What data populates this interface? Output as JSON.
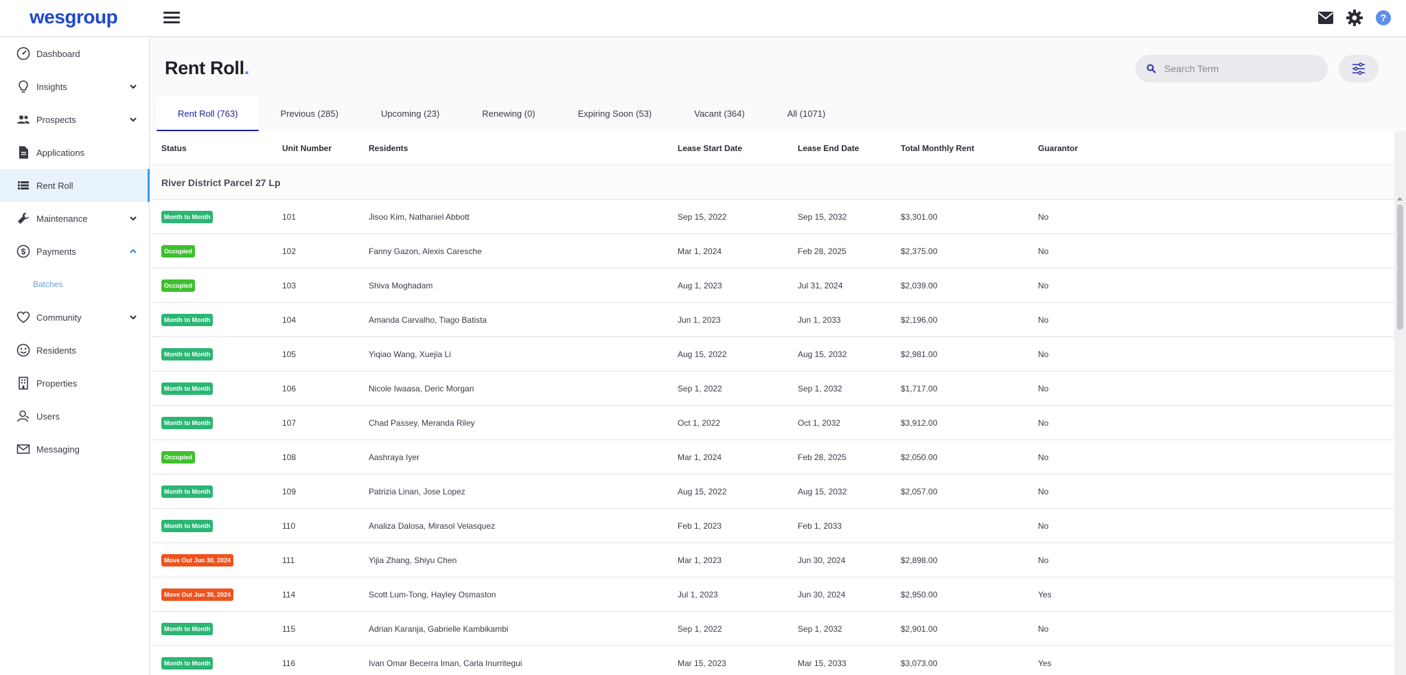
{
  "header": {
    "logo_text": "wesgroup"
  },
  "sidebar": {
    "items": [
      {
        "name": "dashboard",
        "label": "Dashboard",
        "icon": "dashboard-icon"
      },
      {
        "name": "insights",
        "label": "Insights",
        "icon": "lightbulb-icon",
        "expandable": true
      },
      {
        "name": "prospects",
        "label": "Prospects",
        "icon": "people-icon",
        "expandable": true
      },
      {
        "name": "applications",
        "label": "Applications",
        "icon": "document-icon"
      },
      {
        "name": "rent-roll",
        "label": "Rent Roll",
        "icon": "list-icon",
        "active": true
      },
      {
        "name": "maintenance",
        "label": "Maintenance",
        "icon": "wrench-icon",
        "expandable": true
      },
      {
        "name": "payments",
        "label": "Payments",
        "icon": "dollar-icon",
        "expandable": true,
        "expanded": true
      },
      {
        "name": "community",
        "label": "Community",
        "icon": "heart-icon",
        "expandable": true
      },
      {
        "name": "residents",
        "label": "Residents",
        "icon": "smile-icon"
      },
      {
        "name": "properties",
        "label": "Properties",
        "icon": "building-icon"
      },
      {
        "name": "users",
        "label": "Users",
        "icon": "user-icon"
      },
      {
        "name": "messaging",
        "label": "Messaging",
        "icon": "mail-icon"
      }
    ],
    "payments_sub": "Batches"
  },
  "page": {
    "title": "Rent Roll",
    "title_suffix": "."
  },
  "search": {
    "placeholder": "Search Term"
  },
  "tabs": [
    {
      "label": "Rent Roll (763)",
      "active": true
    },
    {
      "label": "Previous (285)"
    },
    {
      "label": "Upcoming (23)"
    },
    {
      "label": "Renewing (0)"
    },
    {
      "label": "Expiring Soon (53)"
    },
    {
      "label": "Vacant (364)"
    },
    {
      "label": "All (1071)"
    }
  ],
  "table": {
    "columns": [
      "Status",
      "Unit Number",
      "Residents",
      "Lease Start Date",
      "Lease End Date",
      "Total Monthly Rent",
      "Guarantor"
    ],
    "group": "River District Parcel 27 Lp",
    "rows": [
      {
        "status": "Month to Month",
        "type": "mtm",
        "unit": "101",
        "residents": "Jisoo Kim, Nathaniel Abbott",
        "start": "Sep 15, 2022",
        "end": "Sep 15, 2032",
        "rent": "$3,301.00",
        "guarantor": "No"
      },
      {
        "status": "Occupied",
        "type": "occ",
        "unit": "102",
        "residents": "Fanny Gazon, Alexis Caresche",
        "start": "Mar 1, 2024",
        "end": "Feb 28, 2025",
        "rent": "$2,375.00",
        "guarantor": "No"
      },
      {
        "status": "Occupied",
        "type": "occ",
        "unit": "103",
        "residents": "Shiva Moghadam",
        "start": "Aug 1, 2023",
        "end": "Jul 31, 2024",
        "rent": "$2,039.00",
        "guarantor": "No"
      },
      {
        "status": "Month to Month",
        "type": "mtm",
        "unit": "104",
        "residents": "Amanda Carvalho, Tiago Batista",
        "start": "Jun 1, 2023",
        "end": "Jun 1, 2033",
        "rent": "$2,196.00",
        "guarantor": "No"
      },
      {
        "status": "Month to Month",
        "type": "mtm",
        "unit": "105",
        "residents": "Yiqiao Wang, Xuejia Li",
        "start": "Aug 15, 2022",
        "end": "Aug 15, 2032",
        "rent": "$2,981.00",
        "guarantor": "No"
      },
      {
        "status": "Month to Month",
        "type": "mtm",
        "unit": "106",
        "residents": "Nicole Iwaasa, Deric Morgan",
        "start": "Sep 1, 2022",
        "end": "Sep 1, 2032",
        "rent": "$1,717.00",
        "guarantor": "No"
      },
      {
        "status": "Month to Month",
        "type": "mtm",
        "unit": "107",
        "residents": "Chad Passey, Meranda Riley",
        "start": "Oct 1, 2022",
        "end": "Oct 1, 2032",
        "rent": "$3,912.00",
        "guarantor": "No"
      },
      {
        "status": "Occupied",
        "type": "occ",
        "unit": "108",
        "residents": "Aashraya Iyer",
        "start": "Mar 1, 2024",
        "end": "Feb 28, 2025",
        "rent": "$2,050.00",
        "guarantor": "No"
      },
      {
        "status": "Month to Month",
        "type": "mtm",
        "unit": "109",
        "residents": "Patrizia Linan, Jose Lopez",
        "start": "Aug 15, 2022",
        "end": "Aug 15, 2032",
        "rent": "$2,057.00",
        "guarantor": "No"
      },
      {
        "status": "Month to Month",
        "type": "mtm",
        "unit": "110",
        "residents": "Analiza Dalosa, Mirasol Velasquez",
        "start": "Feb 1, 2023",
        "end": "Feb 1, 2033",
        "rent": "",
        "guarantor": "No"
      },
      {
        "status": "Move Out Jun 30, 2024",
        "type": "mo",
        "unit": "111",
        "residents": "Yijia Zhang, Shiyu Chen",
        "start": "Mar 1, 2023",
        "end": "Jun 30, 2024",
        "rent": "$2,898.00",
        "guarantor": "No"
      },
      {
        "status": "Move Out Jun 30, 2024",
        "type": "mo",
        "unit": "114",
        "residents": "Scott Lum-Tong, Hayley Osmaston",
        "start": "Jul 1, 2023",
        "end": "Jun 30, 2024",
        "rent": "$2,950.00",
        "guarantor": "Yes"
      },
      {
        "status": "Month to Month",
        "type": "mtm",
        "unit": "115",
        "residents": "Adrian Karanja, Gabrielle Kambikambi",
        "start": "Sep 1, 2022",
        "end": "Sep 1, 2032",
        "rent": "$2,901.00",
        "guarantor": "No"
      },
      {
        "status": "Month to Month",
        "type": "mtm",
        "unit": "116",
        "residents": "Ivan Omar Becerra Iman, Carla Inurritegui",
        "start": "Mar 15, 2023",
        "end": "Mar 15, 2033",
        "rent": "$3,073.00",
        "guarantor": "Yes"
      }
    ]
  }
}
